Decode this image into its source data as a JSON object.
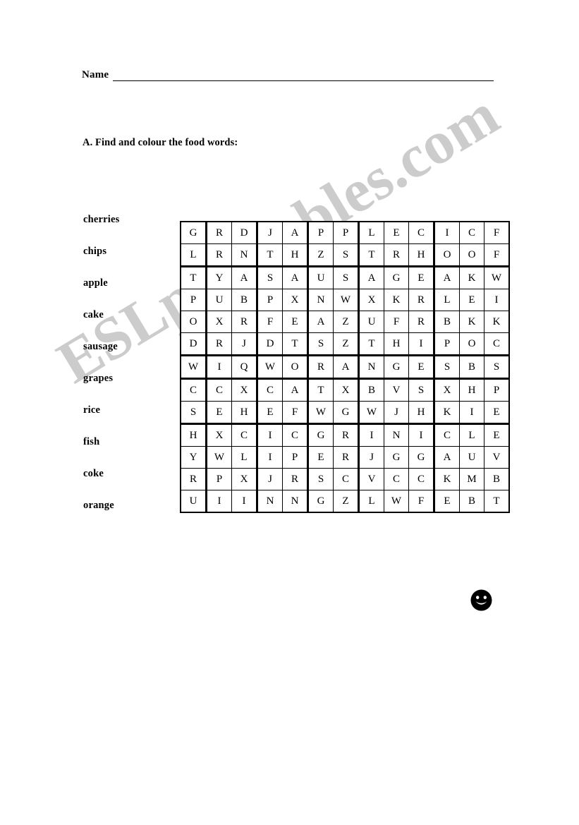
{
  "worksheet": {
    "name_label": "Name",
    "instruction": "A. Find and colour the food words:",
    "watermark": "ESLprintables.com",
    "watermark_color": "#cccccc",
    "smiley_icon": "smiley-face-icon"
  },
  "word_list": {
    "items": [
      {
        "word": "cherries"
      },
      {
        "word": "chips"
      },
      {
        "word": "apple"
      },
      {
        "word": "cake"
      },
      {
        "word": "sausage"
      },
      {
        "word": "grapes"
      },
      {
        "word": "rice"
      },
      {
        "word": "fish"
      },
      {
        "word": "coke"
      },
      {
        "word": "orange"
      }
    ]
  },
  "grid": {
    "rows": 13,
    "cols": 13,
    "column_separators_after": [
      1,
      3,
      5,
      7,
      10
    ],
    "row_separators_after": [
      2,
      6,
      7,
      9
    ],
    "letters": [
      [
        "G",
        "R",
        "D",
        "J",
        "A",
        "P",
        "P",
        "L",
        "E",
        "C",
        "I",
        "C",
        "F"
      ],
      [
        "L",
        "R",
        "N",
        "T",
        "H",
        "Z",
        "S",
        "T",
        "R",
        "H",
        "O",
        "O",
        "F"
      ],
      [
        "T",
        "Y",
        "A",
        "S",
        "A",
        "U",
        "S",
        "A",
        "G",
        "E",
        "A",
        "K",
        "W"
      ],
      [
        "P",
        "U",
        "B",
        "P",
        "X",
        "N",
        "W",
        "X",
        "K",
        "R",
        "L",
        "E",
        "I"
      ],
      [
        "O",
        "X",
        "R",
        "F",
        "E",
        "A",
        "Z",
        "U",
        "F",
        "R",
        "B",
        "K",
        "K"
      ],
      [
        "D",
        "R",
        "J",
        "D",
        "T",
        "S",
        "Z",
        "T",
        "H",
        "I",
        "P",
        "O",
        "C"
      ],
      [
        "W",
        "I",
        "Q",
        "W",
        "O",
        "R",
        "A",
        "N",
        "G",
        "E",
        "S",
        "B",
        "S"
      ],
      [
        "C",
        "C",
        "X",
        "C",
        "A",
        "T",
        "X",
        "B",
        "V",
        "S",
        "X",
        "H",
        "P"
      ],
      [
        "S",
        "E",
        "H",
        "E",
        "F",
        "W",
        "G",
        "W",
        "J",
        "H",
        "K",
        "I",
        "E"
      ],
      [
        "H",
        "X",
        "C",
        "I",
        "C",
        "G",
        "R",
        "I",
        "N",
        "I",
        "C",
        "L",
        "E"
      ],
      [
        "Y",
        "W",
        "L",
        "I",
        "P",
        "E",
        "R",
        "J",
        "G",
        "G",
        "A",
        "U",
        "V"
      ],
      [
        "R",
        "P",
        "X",
        "J",
        "R",
        "S",
        "C",
        "V",
        "C",
        "C",
        "K",
        "M",
        "B"
      ],
      [
        "U",
        "I",
        "I",
        "N",
        "N",
        "G",
        "Z",
        "L",
        "W",
        "F",
        "E",
        "B",
        "T"
      ]
    ]
  }
}
